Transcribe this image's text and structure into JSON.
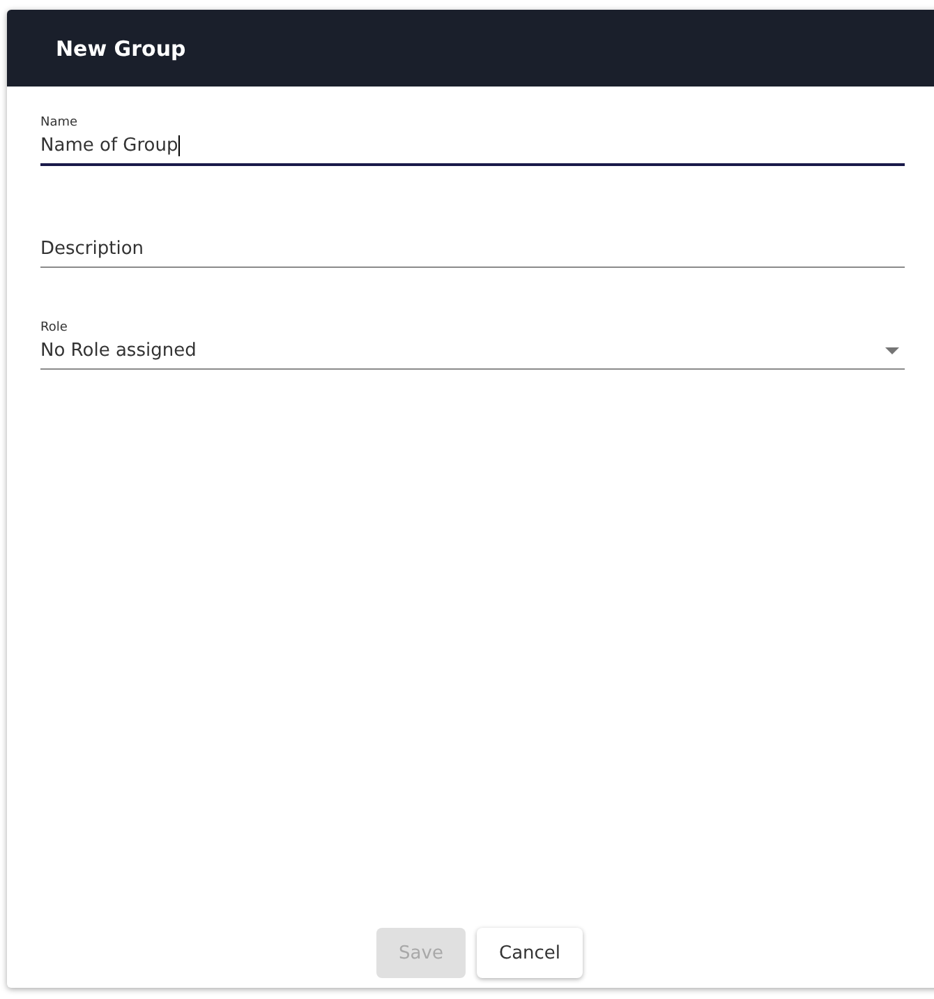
{
  "dialog": {
    "title": "New Group"
  },
  "fields": [
    {
      "kind": "text",
      "label": "Name",
      "value": "Name of Group",
      "focused": true
    },
    {
      "kind": "text",
      "label": "Description",
      "focused": false
    },
    {
      "kind": "select",
      "label": "Role",
      "value": "No Role assigned",
      "focused": false
    }
  ],
  "buttons": [
    {
      "label": "Save",
      "disabled": true
    },
    {
      "label": "Cancel",
      "disabled": false
    }
  ]
}
